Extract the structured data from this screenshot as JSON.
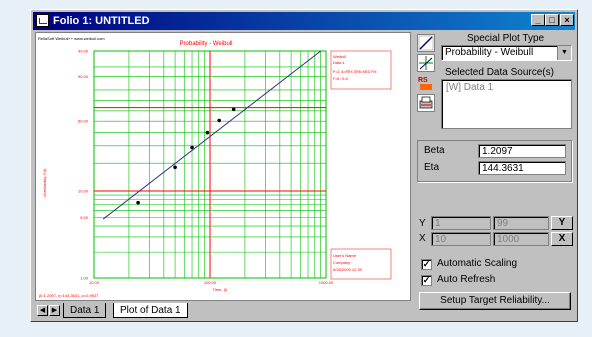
{
  "window": {
    "title": "Folio 1: UNTITLED",
    "min_glyph": "_",
    "max_glyph": "□",
    "close_glyph": "×"
  },
  "plot": {
    "top_left_caption": "ReliaSoft Weibull++ www.weibull.com",
    "title": "Probability - Weibull",
    "y_axis_label": "Unreliability, F(t)",
    "x_axis_label": "Time, (t)",
    "legend": [
      "Weibull",
      "Data 1",
      "P=2, A=RRX SRM MED FM",
      "F=8 / S=0"
    ],
    "user_box": [
      "User's Name",
      "Company",
      "6/28/2000 12:30"
    ],
    "footer": "β=1.2097, η=144.3631, ρ=0.9927",
    "accent_color": "#ff0000",
    "grid_color": "#00c000"
  },
  "chart_data": {
    "type": "scatter",
    "title": "Probability - Weibull",
    "xlabel": "Time, (t)",
    "ylabel": "Unreliability, F(t)",
    "x_scale": "log",
    "y_scale": "weibull",
    "x_ticks": [
      "10.00",
      "100.00",
      "1000.00"
    ],
    "y_ticks": [
      "99.00",
      "90.00",
      "50.00",
      "10.00",
      "5.00",
      "1.00"
    ],
    "grid": true,
    "series": [
      {
        "x": [
          24,
          50,
          70,
          95,
          120,
          160
        ],
        "y": [
          7.4,
          18.1,
          28.9,
          39.8,
          50.6,
          61.5
        ]
      }
    ],
    "fit_line": {
      "beta": 1.2097,
      "eta": 144.3631
    }
  },
  "panel": {
    "special_plot_label": "Special Plot Type",
    "plot_type_value": "Probability - Weibull",
    "data_source_label": "Selected Data Source(s)",
    "data_sources": [
      "[W] Data 1"
    ],
    "beta_label": "Beta",
    "beta_value": "1.2097",
    "eta_label": "Eta",
    "eta_value": "144.3631",
    "y_label": "Y",
    "y_min": "1",
    "y_max": "99",
    "x_label": "X",
    "x_min": "10",
    "x_max": "1000",
    "y_btn": "Y",
    "x_btn": "X",
    "auto_scaling_label": "Automatic Scaling",
    "auto_refresh_label": "Auto Refresh",
    "auto_scaling_checked": true,
    "auto_refresh_checked": true,
    "setup_button": "Setup Target Reliability..."
  },
  "tabs": [
    "Data 1",
    "Plot of Data 1"
  ],
  "icons": [
    "plot-type-icon",
    "crosshair-icon",
    "rs-data-icon",
    "print-icon"
  ]
}
